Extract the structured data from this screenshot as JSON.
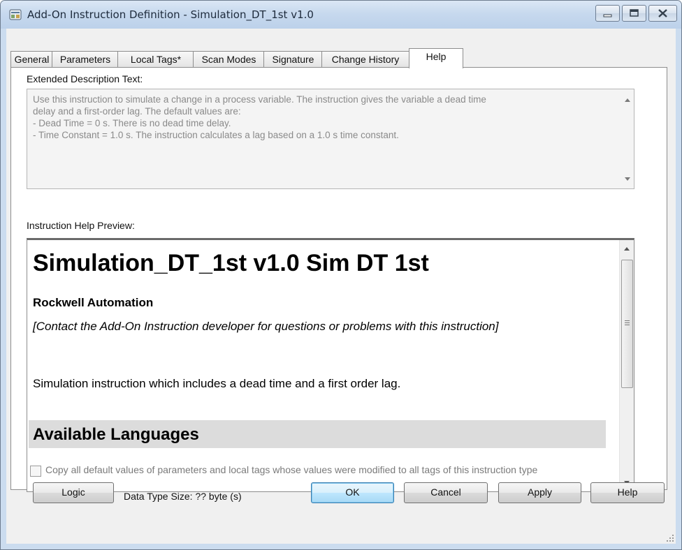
{
  "window": {
    "title": "Add-On Instruction Definition - Simulation_DT_1st v1.0",
    "icon": "add-on-instruction-icon"
  },
  "caption_buttons": [
    "minimize-icon",
    "maximize-icon",
    "close-icon"
  ],
  "tabs": [
    {
      "label": "General"
    },
    {
      "label": "Parameters"
    },
    {
      "label": "Local Tags*"
    },
    {
      "label": "Scan Modes"
    },
    {
      "label": "Signature"
    },
    {
      "label": "Change History"
    },
    {
      "label": "Help",
      "active": true
    }
  ],
  "help": {
    "extended_label": "Extended Description Text:",
    "extended_text": "Use this instruction to simulate a change in a process variable. The instruction gives the variable a dead time\ndelay and a first-order lag. The default values are:\n- Dead Time = 0 s. There is no dead time delay.\n- Time Constant = 1.0 s. The instruction calculates a lag based on a 1.0 s time constant.",
    "preview_label": "Instruction Help Preview:",
    "preview": {
      "title": "Simulation_DT_1st v1.0 Sim DT 1st",
      "vendor": "Rockwell Automation",
      "contact": "[Contact the Add-On Instruction developer for questions or problems with this instruction]",
      "description": "Simulation instruction which includes a dead time and a first order lag.",
      "section": "Available Languages"
    }
  },
  "footer": {
    "copy_defaults_label": "Copy all default values of parameters and local tags whose values were modified to all tags of this instruction type",
    "copy_defaults_checked": false,
    "logic_label": "Logic",
    "data_type_size": "Data Type Size: ?? byte (s)",
    "ok_label": "OK",
    "cancel_label": "Cancel",
    "apply_label": "Apply",
    "help_label": "Help"
  }
}
